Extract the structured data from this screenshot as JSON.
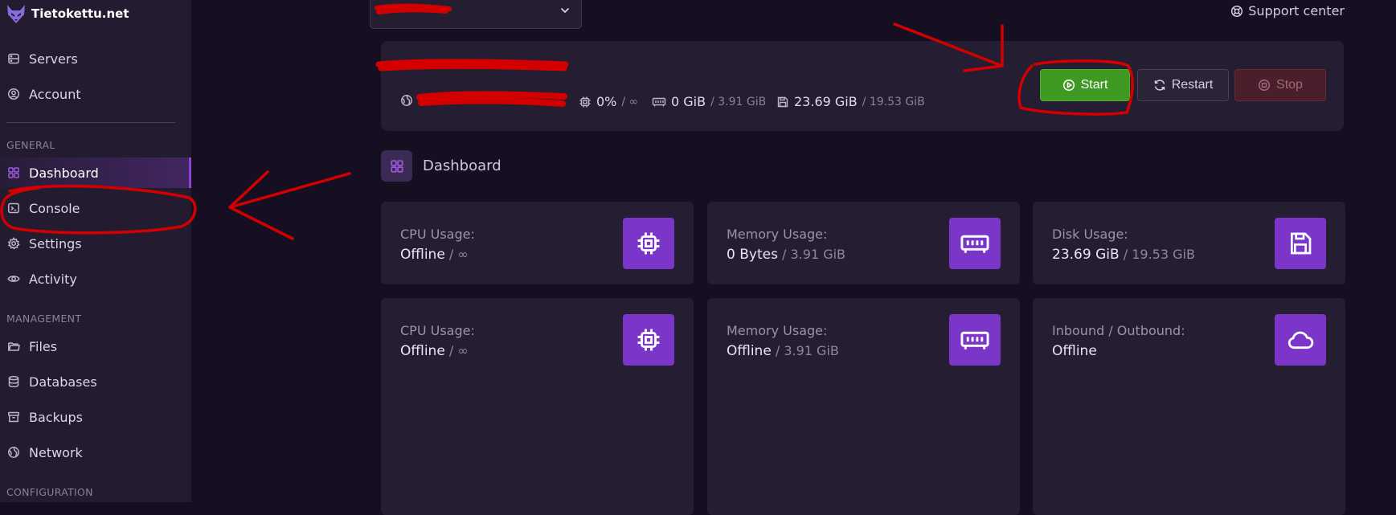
{
  "brand": {
    "name": "Tietokettu.net"
  },
  "sidebar": {
    "top_items": [
      {
        "label": "Servers",
        "icon": "server-icon"
      },
      {
        "label": "Account",
        "icon": "account-icon"
      }
    ],
    "sections": [
      {
        "title": "GENERAL",
        "items": [
          {
            "label": "Dashboard",
            "icon": "dashboard-icon",
            "active": true
          },
          {
            "label": "Console",
            "icon": "console-icon"
          },
          {
            "label": "Settings",
            "icon": "gear-icon"
          },
          {
            "label": "Activity",
            "icon": "eye-icon"
          }
        ]
      },
      {
        "title": "MANAGEMENT",
        "items": [
          {
            "label": "Files",
            "icon": "folder-icon"
          },
          {
            "label": "Databases",
            "icon": "database-icon"
          },
          {
            "label": "Backups",
            "icon": "archive-icon"
          },
          {
            "label": "Network",
            "icon": "globe-icon"
          }
        ]
      },
      {
        "title": "CONFIGURATION",
        "items": []
      }
    ]
  },
  "topbar": {
    "support_label": "Support center"
  },
  "server": {
    "stats": {
      "cpu": {
        "value": "0%",
        "limit": "/ ∞"
      },
      "memory": {
        "value": "0 GiB",
        "limit": "/ 3.91 GiB"
      },
      "disk": {
        "value": "23.69 GiB",
        "limit": "/ 19.53 GiB"
      }
    },
    "buttons": {
      "start": "Start",
      "restart": "Restart",
      "stop": "Stop"
    }
  },
  "dashboard": {
    "title": "Dashboard",
    "cards": [
      {
        "label": "CPU Usage:",
        "value": "Offline",
        "sub": " / ∞",
        "icon": "cpu-icon"
      },
      {
        "label": "Memory Usage:",
        "value": "0 Bytes",
        "sub": " / 3.91 GiB",
        "icon": "memory-icon"
      },
      {
        "label": "Disk Usage:",
        "value": "23.69 GiB",
        "sub": " / 19.53 GiB",
        "icon": "save-icon"
      },
      {
        "label": "CPU Usage:",
        "value": "Offline",
        "sub": " / ∞",
        "icon": "cpu-icon"
      },
      {
        "label": "Memory Usage:",
        "value": "Offline",
        "sub": " / 3.91 GiB",
        "icon": "memory-icon"
      },
      {
        "label": "Inbound / Outbound:",
        "value": "Offline",
        "sub": "",
        "icon": "cloud-icon"
      }
    ]
  },
  "colors": {
    "accent": "#7b35c9",
    "start": "#3f9a24",
    "stop": "#4a1e2a",
    "annotation": "#d40000"
  }
}
